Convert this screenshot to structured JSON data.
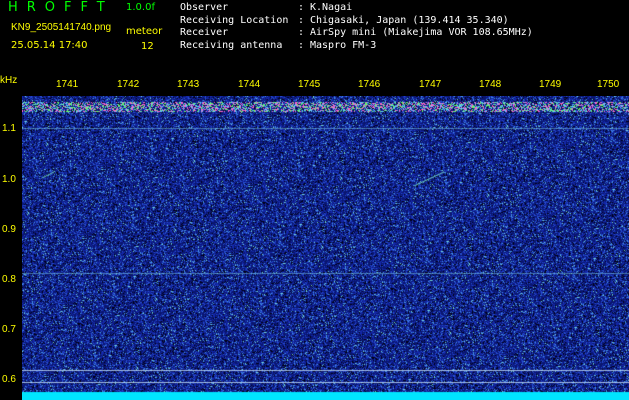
{
  "header": {
    "app_title": "HROFFT",
    "version": "1.0.0f",
    "filename": "KN9_2505141740.png",
    "mode": "meteor",
    "datetime": "25.05.14 17:40",
    "count": "12"
  },
  "meta": [
    {
      "key": "Observer",
      "value": "K.Nagai"
    },
    {
      "key": "Receiving Location",
      "value": "Chigasaki, Japan (139.414 35.340)"
    },
    {
      "key": "Receiver",
      "value": "AirSpy mini (Miakejima VOR 108.65MHz)"
    },
    {
      "key": "Receiving antenna",
      "value": "Maspro FM-3"
    }
  ],
  "axis": {
    "unit": "kHz",
    "time_labels": [
      "1741",
      "1742",
      "1743",
      "1744",
      "1745",
      "1746",
      "1747",
      "1748",
      "1749",
      "1750"
    ],
    "freq_labels": [
      "1.1",
      "1.0",
      "0.9",
      "0.8",
      "0.7",
      "0.6"
    ]
  },
  "colors": {
    "background_noise": "#0a1a7a",
    "carrier": "#ff66cc",
    "label": "#ffff00",
    "accent": "#00ff00"
  }
}
